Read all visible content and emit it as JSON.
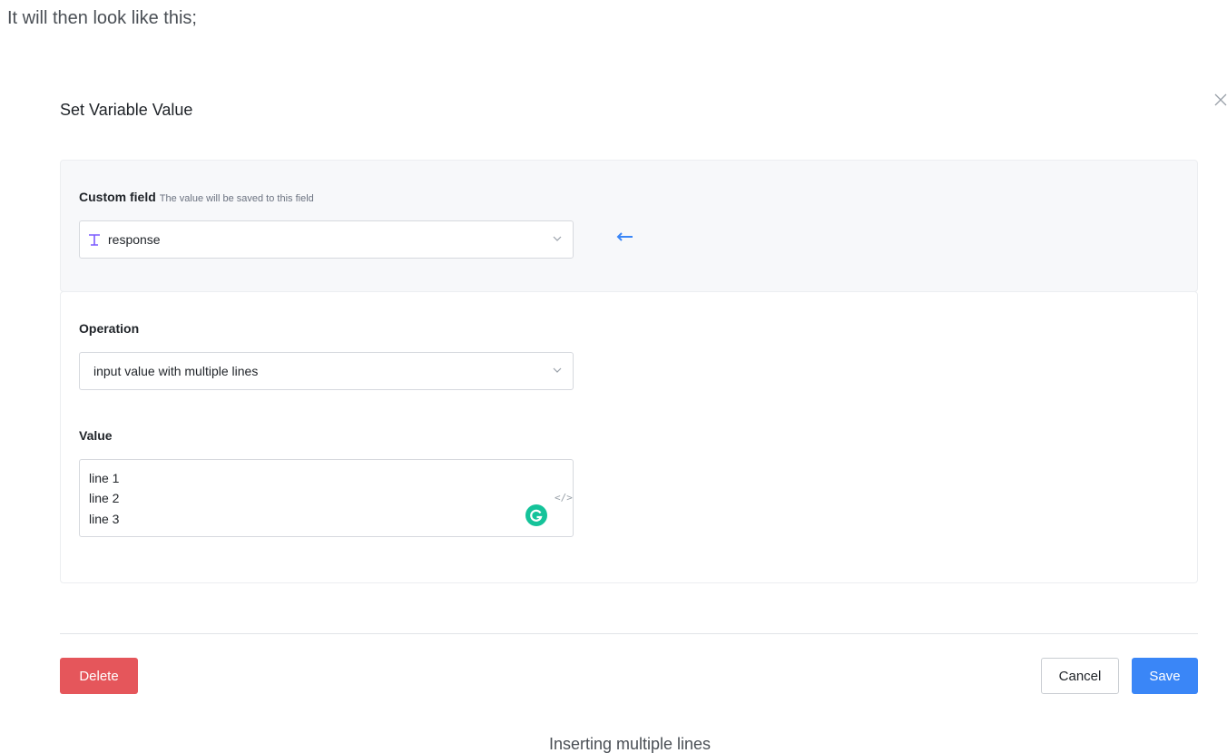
{
  "intro_text": "It will then look like this;",
  "caption": "Inserting multiple lines",
  "modal": {
    "title": "Set Variable Value",
    "close_icon": "close-icon",
    "custom_field": {
      "label": "Custom field",
      "hint": "The value will be saved to this field",
      "selected_value": "response",
      "type_icon": "text-type-icon"
    },
    "operation": {
      "label": "Operation",
      "selected_value": "input value with multiple lines"
    },
    "value": {
      "label": "Value",
      "lines": [
        "line 1",
        "line 2",
        "line 3"
      ]
    },
    "buttons": {
      "delete": "Delete",
      "cancel": "Cancel",
      "save": "Save"
    }
  },
  "colors": {
    "delete": "#e5565b",
    "save": "#3a86f7",
    "arrow": "#3a86f7",
    "type_icon": "#7c5cff",
    "grammarly": "#15c39a"
  }
}
